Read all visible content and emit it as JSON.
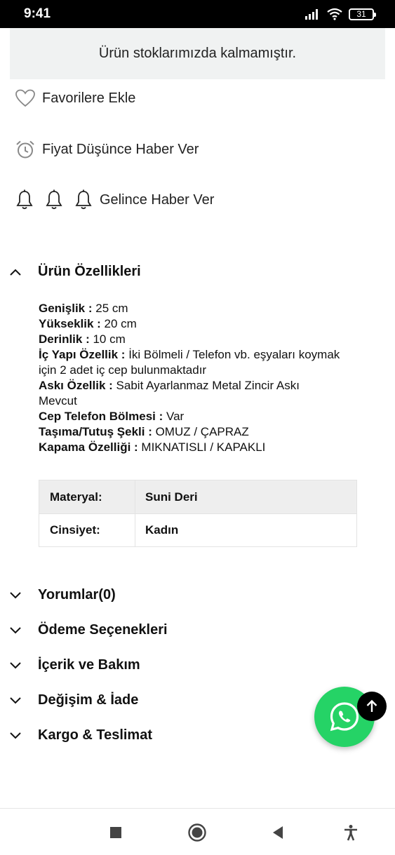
{
  "status_bar": {
    "time": "9:41",
    "battery": "31"
  },
  "stock_notice": "Ürün stoklarımızda kalmamıştır.",
  "actions": {
    "favorite": "Favorilere Ekle",
    "price_alert": "Fiyat Düşünce Haber Ver",
    "stock_alert": "Gelince Haber Ver"
  },
  "features": {
    "title": "Ürün Özellikleri",
    "specs": [
      {
        "key": "Genişlik :",
        "value": " 25 cm"
      },
      {
        "key": "Yükseklik :",
        "value": " 20 cm"
      },
      {
        "key": "Derinlik :",
        "value": " 10 cm"
      },
      {
        "key": "İç Yapı Özellik :",
        "value": " İki Bölmeli / Telefon vb. eşyaları koymak için 2 adet iç cep bulunmaktadır"
      },
      {
        "key": "Askı Özellik :",
        "value": " Sabit Ayarlanmaz Metal Zincir Askı Mevcut"
      },
      {
        "key": "Cep Telefon Bölmesi :",
        "value": " Var"
      },
      {
        "key": "Taşıma/Tutuş Şekli :",
        "value": " OMUZ / ÇAPRAZ"
      },
      {
        "key": "Kapama Özelliği :",
        "value": " MIKNATISLI / KAPAKLI"
      }
    ],
    "table": [
      {
        "key": "Materyal:",
        "value": "Suni Deri"
      },
      {
        "key": "Cinsiyet:",
        "value": "Kadın"
      }
    ]
  },
  "sections": [
    "Yorumlar(0)",
    "Ödeme Seçenekleri",
    "İçerik ve Bakım",
    "Değişim & İade",
    "Kargo & Teslimat"
  ],
  "colors": {
    "whatsapp": "#25d366",
    "notice_bg": "#f0f2f2"
  },
  "icons": {
    "favorite": "heart-icon",
    "price_alert": "alarm-clock-icon",
    "stock_alert": "bell-icon",
    "whatsapp": "whatsapp-icon",
    "scroll_top": "arrow-up-icon"
  }
}
